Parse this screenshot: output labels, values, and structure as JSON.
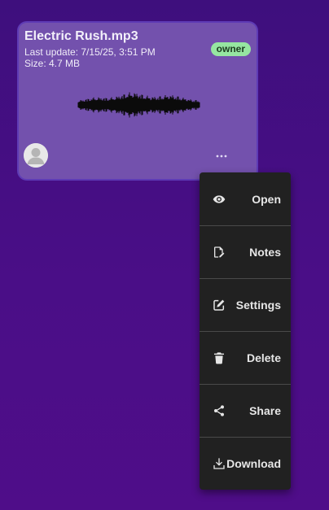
{
  "file_card": {
    "title": "Electric Rush.mp3",
    "last_update": "Last update: 7/15/25, 3:51 PM",
    "size": "Size: 4.7 MB",
    "role_badge": "owner",
    "thumbnail_icon": "audio-waveform",
    "avatar_icon": "default-user-avatar",
    "more_icon": "more-horizontal-icon"
  },
  "context_menu": {
    "items": [
      {
        "label": "Open",
        "icon": "eye-icon"
      },
      {
        "label": "Notes",
        "icon": "note-edit-icon"
      },
      {
        "label": "Settings",
        "icon": "edit-square-icon"
      },
      {
        "label": "Delete",
        "icon": "trash-icon"
      },
      {
        "label": "Share",
        "icon": "share-icon"
      },
      {
        "label": "Download",
        "icon": "download-icon"
      }
    ]
  },
  "colors": {
    "background": "#4a0e87",
    "card": "#7351ad",
    "card_border": "#5e3bb5",
    "badge": "#96e6a1",
    "menu": "#212121",
    "menu_divider": "#4a4a4a"
  }
}
